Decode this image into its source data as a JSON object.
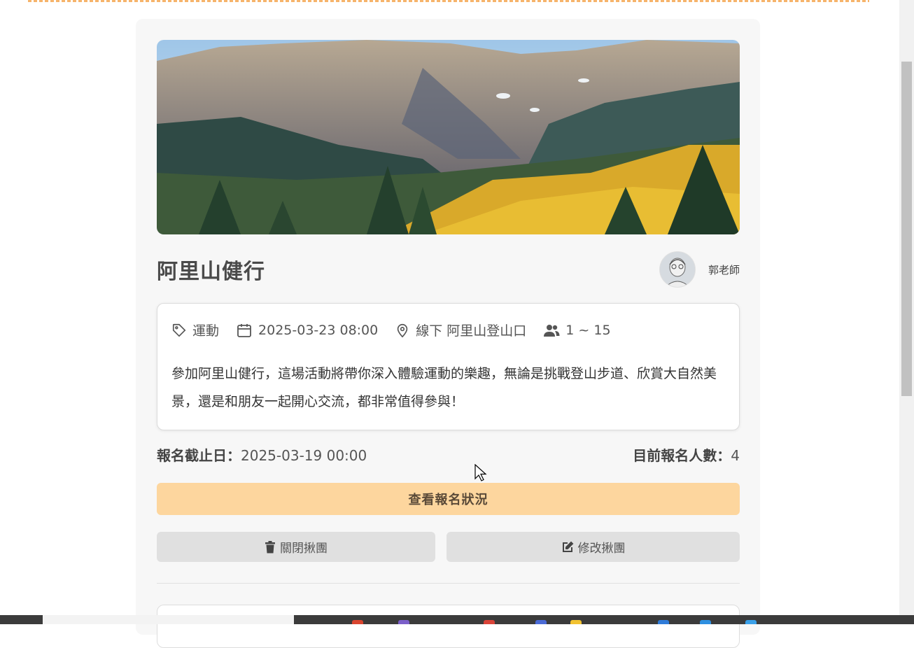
{
  "event": {
    "title": "阿里山健行",
    "host_name": "郭老師",
    "category": "運動",
    "datetime": "2025-03-23 08:00",
    "location": "線下 阿里山登山口",
    "participants_range": "1 ~ 15",
    "description": "參加阿里山健行，這場活動將帶你深入體驗運動的樂趣，無論是挑戰登山步道、欣賞大自然美景，還是和朋友一起開心交流，都非常值得參與！",
    "deadline_label": "報名截止日：",
    "deadline_value": "2025-03-19 00:00",
    "count_label": "目前報名人數：",
    "count_value": "4"
  },
  "actions": {
    "view_status": "查看報名狀況",
    "close_group": "關閉揪團",
    "edit_group": "修改揪團"
  },
  "colors": {
    "accent": "#fdd69e",
    "top_border": "#f6b46b",
    "secondary_button": "#e0e0e0"
  },
  "icons": {
    "category": "tag-icon",
    "datetime": "calendar-icon",
    "location": "map-pin-icon",
    "participants": "users-icon",
    "close": "trash-icon",
    "edit": "edit-icon"
  }
}
